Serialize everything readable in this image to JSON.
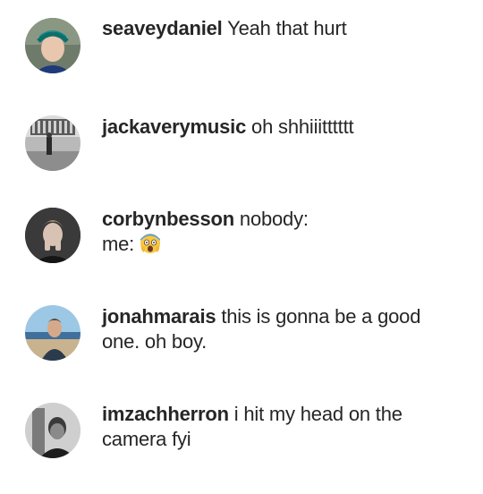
{
  "comments": [
    {
      "username": "seaveydaniel",
      "text": "Yeah that hurt",
      "avatar_icon": "user-photo-seaveydaniel"
    },
    {
      "username": "jackaverymusic",
      "text": "oh shhiiitttttt",
      "avatar_icon": "user-photo-jackaverymusic"
    },
    {
      "username": "corbynbesson",
      "text": "nobody:",
      "text_line2": "me:",
      "emoji": "screaming-face-emoji",
      "avatar_icon": "user-photo-corbynbesson"
    },
    {
      "username": "jonahmarais",
      "text": "this is gonna be a good",
      "text_line2": "one. oh boy.",
      "avatar_icon": "user-photo-jonahmarais"
    },
    {
      "username": "imzachherron",
      "text": "i hit my head on the",
      "text_line2": "camera fyi",
      "avatar_icon": "user-photo-imzachherron"
    }
  ]
}
